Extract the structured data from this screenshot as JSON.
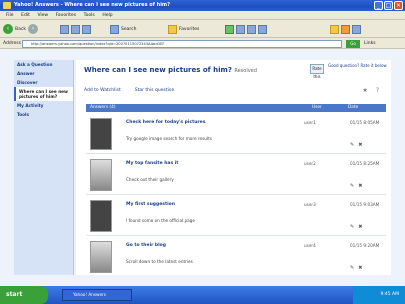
{
  "window": {
    "title": "Yahoo! Answers - Where can I see new pictures of him?"
  },
  "menu": {
    "items": [
      "File",
      "Edit",
      "View",
      "Favorites",
      "Tools",
      "Help"
    ]
  },
  "toolbar": {
    "back": "Back",
    "search": "Search",
    "favorites": "Favorites"
  },
  "address": {
    "label": "Address",
    "url": "http://answers.yahoo.com/question/index?qid=20070115072343AAbcDEF",
    "go": "Go",
    "links": "Links"
  },
  "sidebar": {
    "items": [
      {
        "label": "Ask a Question"
      },
      {
        "label": "Answer"
      },
      {
        "label": "Discover"
      },
      {
        "label": "Where can I see new pictures of him?",
        "active": true
      },
      {
        "label": "My Activity"
      },
      {
        "label": "Tools"
      }
    ]
  },
  "question": {
    "title": "Where can I see new pictures of him?",
    "status": "Resolved",
    "rate_label": "Rate this",
    "rate_text": "Good question? Rate it below"
  },
  "actions": {
    "add_to_watchlist": "Add to Watchlist",
    "star_question": "Star this question"
  },
  "list": {
    "headers": [
      "Answers (4)",
      "User",
      "Date"
    ],
    "rows": [
      {
        "title": "Check here for today's pictures",
        "snippet": "Try google image search for more results",
        "user": "user1",
        "date": "01/15 8:05AM"
      },
      {
        "title": "My top fansite has it",
        "snippet": "Check out their gallery",
        "user": "user2",
        "date": "01/15 8:25AM"
      },
      {
        "title": "My first suggestion",
        "snippet": "I found some on the official page",
        "user": "user3",
        "date": "01/15 9:03AM"
      },
      {
        "title": "Go to their blog",
        "snippet": "Scroll down to the latest entries",
        "user": "user4",
        "date": "01/15 9:20AM"
      }
    ]
  },
  "taskbar": {
    "start": "start",
    "task": "Yahoo! Answers",
    "clock": "9:45 AM"
  }
}
